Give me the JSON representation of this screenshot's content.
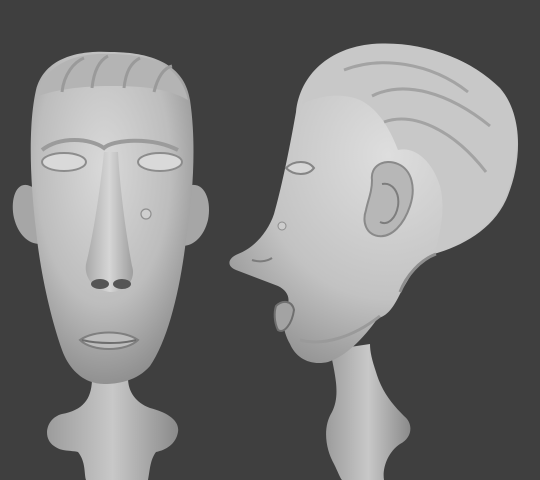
{
  "scene": {
    "background_color": "#3f3f3f",
    "material_color": "#c9c9c9",
    "shadow_color": "#8a8a8a",
    "objects": [
      {
        "name": "front-view-sculpt"
      },
      {
        "name": "side-view-sculpt"
      }
    ]
  }
}
